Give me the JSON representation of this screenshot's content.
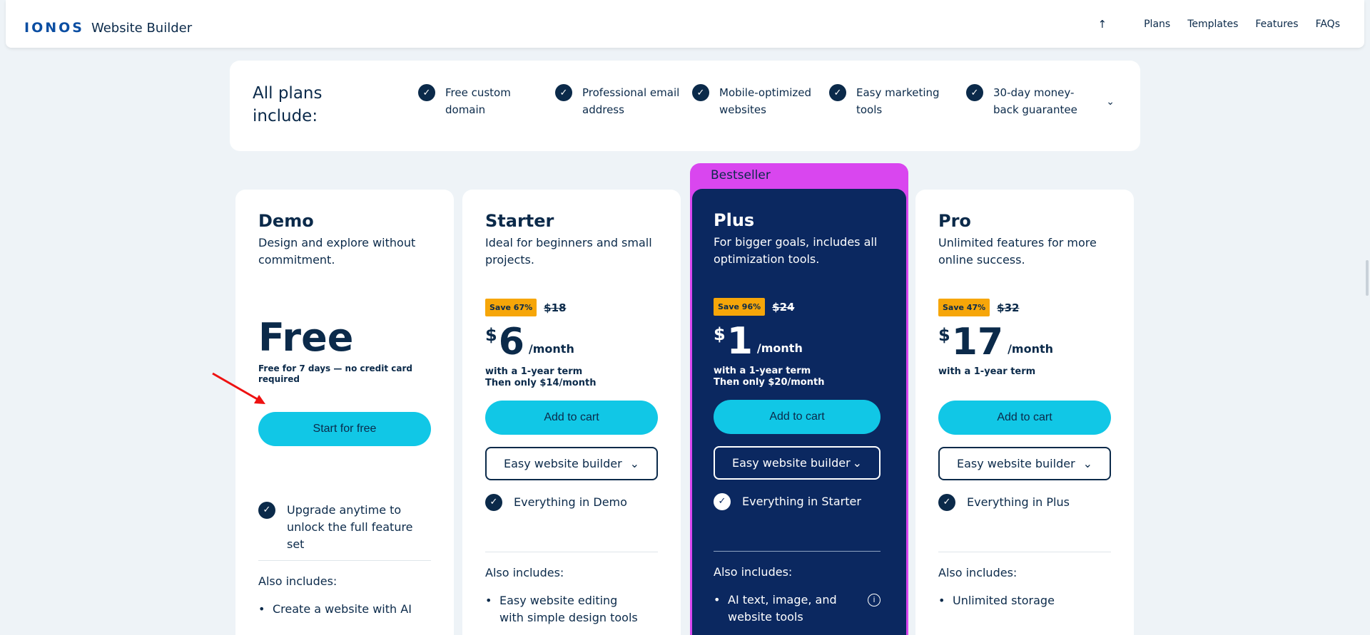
{
  "header": {
    "logo_brand": "IONOS",
    "logo_product": "Website Builder",
    "up_icon": "↑",
    "nav": [
      "Plans",
      "Templates",
      "Features",
      "FAQs"
    ]
  },
  "include": {
    "title": "All plans include:",
    "items": [
      "Free custom domain",
      "Professional email address",
      "Mobile-optimized websites",
      "Easy marketing tools",
      "30-day money-back guarantee"
    ]
  },
  "bestseller": "Bestseller",
  "plans": {
    "demo": {
      "name": "Demo",
      "desc": "Design and explore without commitment.",
      "price": "Free",
      "note": "Free for 7 days — no credit card required",
      "cta": "Start for free",
      "feature": "Upgrade anytime to unlock the full feature set",
      "also": "Also includes:",
      "bullet": "Create a website with AI"
    },
    "starter": {
      "name": "Starter",
      "desc": "Ideal for beginners and small projects.",
      "save": "Save 67%",
      "old": "$18",
      "currency": "$",
      "amount": "6",
      "per": "/month",
      "term1": "with a 1-year term",
      "term2": "Then only $14/month",
      "cta": "Add to cart",
      "select": "Easy website builder",
      "feature": "Everything in Demo",
      "also": "Also includes:",
      "bullet": "Easy website editing with simple design tools"
    },
    "plus": {
      "name": "Plus",
      "desc": "For bigger goals, includes all optimization tools.",
      "save": "Save 96%",
      "old": "$24",
      "currency": "$",
      "amount": "1",
      "per": "/month",
      "term1": "with a 1-year term",
      "term2": "Then only $20/month",
      "cta": "Add to cart",
      "select": "Easy website builder",
      "feature": "Everything in Starter",
      "also": "Also includes:",
      "bullet": "AI text, image, and website tools"
    },
    "pro": {
      "name": "Pro",
      "desc": "Unlimited features for more online success.",
      "save": "Save 47%",
      "old": "$32",
      "currency": "$",
      "amount": "17",
      "per": "/month",
      "term1": "with a 1-year term",
      "cta": "Add to cart",
      "select": "Easy website builder",
      "feature": "Everything in Plus",
      "also": "Also includes:",
      "bullet": "Unlimited storage"
    }
  },
  "colors": {
    "navy": "#0b2a4a",
    "plus_bg": "#0b2860",
    "bestseller": "#d946ef",
    "cta": "#11c7e6",
    "save_badge": "#f6a609"
  }
}
